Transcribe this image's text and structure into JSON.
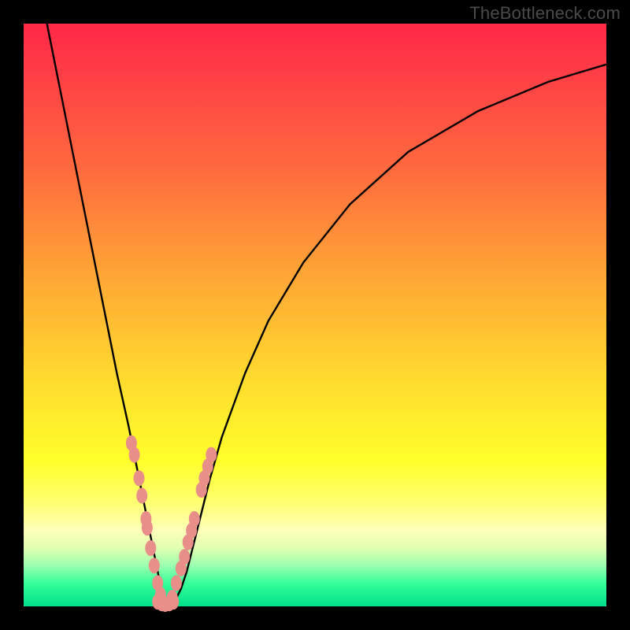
{
  "watermark": {
    "text": "TheBottleneck.com"
  },
  "colors": {
    "frame": "#000000",
    "gradient_css": "linear-gradient(to bottom, #ff2846 0%, #ff3a46 7%, #ff6a3e 25%, #ffa236 42%, #ffd82e 60%, #ffff2a 75%, #feff6e 82%, #fdffb8 87%, #e0ffb0 90%, #9bffb0 93%, #36ff9a 96%, #00e08a 100%)",
    "curve": "#000000",
    "marker_fill": "#e88f8a",
    "marker_stroke": "#d87b76"
  },
  "chart_data": {
    "type": "line",
    "title": "",
    "xlabel": "",
    "ylabel": "",
    "xlim": [
      0,
      100
    ],
    "ylim": [
      0,
      100
    ],
    "grid": false,
    "legend": false,
    "description": "A V-shaped bottleneck curve. Value reaches 0 (green, no bottleneck) near x≈24 and rises sharply on both sides (red, severe bottleneck).",
    "series": [
      {
        "name": "bottleneck-curve",
        "x": [
          4,
          6,
          8,
          10,
          12,
          14,
          16,
          18,
          20,
          21,
          22,
          23,
          24,
          25,
          26,
          27,
          28,
          29,
          30,
          32,
          34,
          38,
          42,
          48,
          56,
          66,
          78,
          90,
          100
        ],
        "values": [
          100,
          90,
          80,
          70,
          60,
          50,
          40,
          31,
          21,
          16,
          11,
          6,
          1,
          0.5,
          1,
          3,
          6,
          10,
          14,
          22,
          29,
          40,
          49,
          59,
          69,
          78,
          85,
          90,
          93
        ]
      },
      {
        "name": "markers-left",
        "type": "scatter",
        "x": [
          18.5,
          19.0,
          19.8,
          20.3,
          21.0,
          21.2,
          21.8,
          22.4,
          23.0,
          23.5
        ],
        "values": [
          28,
          26,
          22,
          19,
          15,
          13.5,
          10,
          7,
          4,
          2
        ]
      },
      {
        "name": "markers-right",
        "type": "scatter",
        "x": [
          25.5,
          26.2,
          27.0,
          27.6,
          28.2,
          28.8,
          29.3,
          30.5,
          31.0,
          31.6,
          32.2
        ],
        "values": [
          1.5,
          4,
          6.5,
          8.5,
          11,
          13,
          15,
          20,
          22,
          24,
          26
        ]
      },
      {
        "name": "markers-bottom",
        "type": "scatter",
        "x": [
          23.0,
          23.7,
          24.3,
          25.0,
          25.7
        ],
        "values": [
          0.8,
          0.5,
          0.4,
          0.5,
          0.8
        ]
      }
    ]
  }
}
